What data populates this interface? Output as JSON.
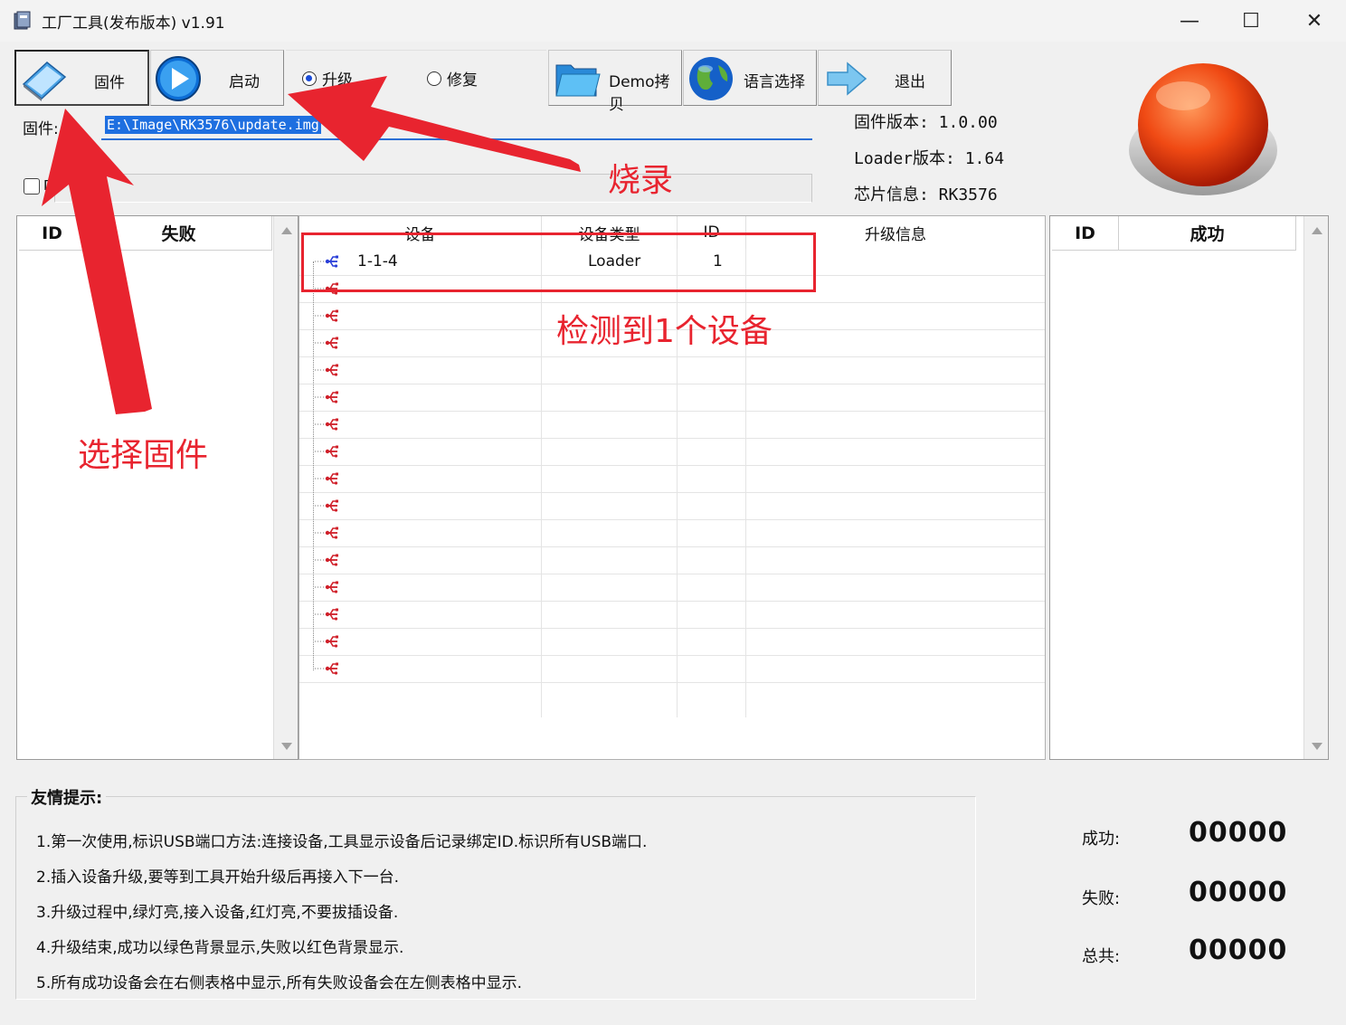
{
  "window": {
    "title": "工厂工具(发布版本) v1.91",
    "minimize": "—",
    "maximize": "☐",
    "close": "✕"
  },
  "toolbar": {
    "firmware_label": "固件",
    "start_label": "启动",
    "upgrade_label": "升级",
    "repair_label": "修复",
    "demo_label": "Demo拷贝",
    "language_label": "语言选择",
    "exit_label": "退出"
  },
  "firmware": {
    "label": "固件:",
    "path": "E:\\Image\\RK3576\\update.img",
    "checkbox_label": "D"
  },
  "info": {
    "fw_version": "固件版本: 1.0.00",
    "loader_version": "Loader版本: 1.64",
    "chip_info": "芯片信息: RK3576"
  },
  "left_table": {
    "col_id": "ID",
    "col_status": "失败"
  },
  "right_table": {
    "col_id": "ID",
    "col_status": "成功"
  },
  "device_table": {
    "headers": [
      "设备",
      "设备类型",
      "ID",
      "升级信息"
    ],
    "rows": [
      {
        "device": "1-1-4",
        "type": "Loader",
        "id": "1",
        "info": "",
        "connected": true
      },
      {
        "connected": false
      },
      {
        "connected": false
      },
      {
        "connected": false
      },
      {
        "connected": false
      },
      {
        "connected": false
      },
      {
        "connected": false
      },
      {
        "connected": false
      },
      {
        "connected": false
      },
      {
        "connected": false
      },
      {
        "connected": false
      },
      {
        "connected": false
      },
      {
        "connected": false
      },
      {
        "connected": false
      },
      {
        "connected": false
      },
      {
        "connected": false
      }
    ]
  },
  "tips": {
    "title": "友情提示:",
    "items": [
      "1.第一次使用,标识USB端口方法:连接设备,工具显示设备后记录绑定ID.标识所有USB端口.",
      "2.插入设备升级,要等到工具开始升级后再接入下一台.",
      "3.升级过程中,绿灯亮,接入设备,红灯亮,不要拔插设备.",
      "4.升级结束,成功以绿色背景显示,失败以红色背景显示.",
      "5.所有成功设备会在右侧表格中显示,所有失败设备会在左侧表格中显示."
    ]
  },
  "stats": {
    "success_label": "成功:",
    "success_value": "00000",
    "fail_label": "失败:",
    "fail_value": "00000",
    "total_label": "总共:",
    "total_value": "00000"
  },
  "annotations": {
    "select_firmware": "选择固件",
    "burn": "烧录",
    "detected": "检测到1个设备"
  },
  "colors": {
    "success": "#2ee830",
    "fail": "#e8101a",
    "annotation": "#e8242f",
    "usb_connected": "#2a3fd8",
    "usb_disconnected": "#d0202a"
  },
  "icons": {
    "app": "app-icon",
    "firmware": "firmware-card-icon",
    "start": "play-icon",
    "demo": "folder-icon",
    "language": "globe-icon",
    "exit": "arrow-right-icon",
    "big_button": "red-push-button-icon",
    "usb": "usb-icon"
  }
}
